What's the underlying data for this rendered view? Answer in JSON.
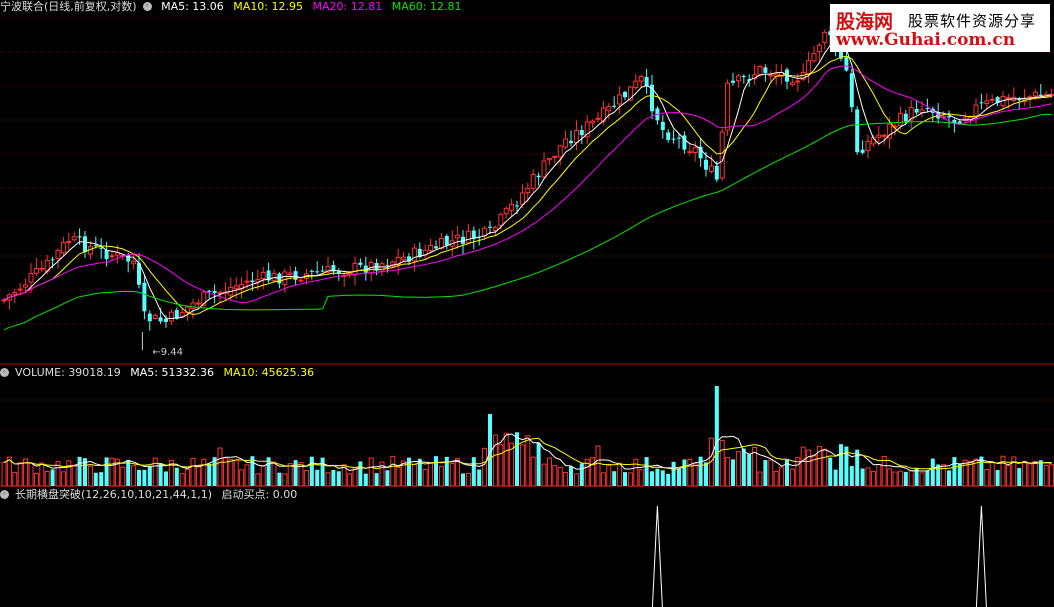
{
  "header": {
    "title": "宁波联合(日线,前复权,对数)",
    "ma5": "MA5: 13.06",
    "ma10": "MA10: 12.95",
    "ma20": "MA20: 12.81",
    "ma60": "MA60: 12.81",
    "low_marker": "9.44"
  },
  "volume_header": {
    "title": "VOLUME: 39018.19",
    "ma5": "MA5: 51332.36",
    "ma10": "MA10: 45625.36"
  },
  "indicator_header": {
    "title": "长期横盘突破(12,26,10,10,21,44,1,1)",
    "value": "启动买点: 0.00"
  },
  "watermark": {
    "brand": "股海网",
    "slogan": "股票软件资源分享",
    "url": "www.Guhai.com.cn"
  },
  "colors": {
    "up": "#ff3232",
    "down": "#54ffff",
    "ma5": "#ffffff",
    "ma10": "#ffff00",
    "ma20": "#ff00ff",
    "ma60": "#00e600",
    "grid": "#8b0000"
  },
  "chart_data": {
    "type": "candlestick",
    "price_low": 9.44,
    "signal_spikes": [
      {
        "candle_index": 121,
        "value": 1
      },
      {
        "candle_index": 181,
        "value": 1
      }
    ]
  }
}
